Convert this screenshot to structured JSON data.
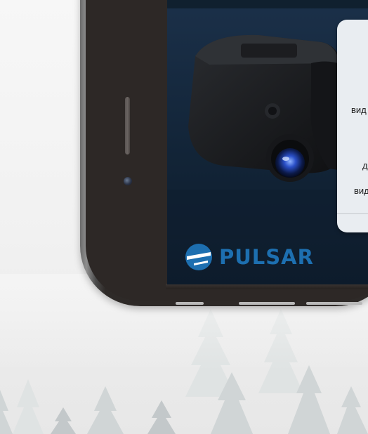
{
  "brand": {
    "name": "PULSAR",
    "color": "#1d6fb0"
  },
  "dialog": {
    "line_1": "вид",
    "line_2": "д",
    "line_3": "вид"
  },
  "icons": {
    "speaker": "earpiece-speaker-icon",
    "camera": "front-camera-icon",
    "logo": "pulsar-logo-icon"
  },
  "colors": {
    "phone_frame": "#2d2826",
    "screen_bg": "#122437",
    "dialog_bg": "#e9edf1"
  }
}
